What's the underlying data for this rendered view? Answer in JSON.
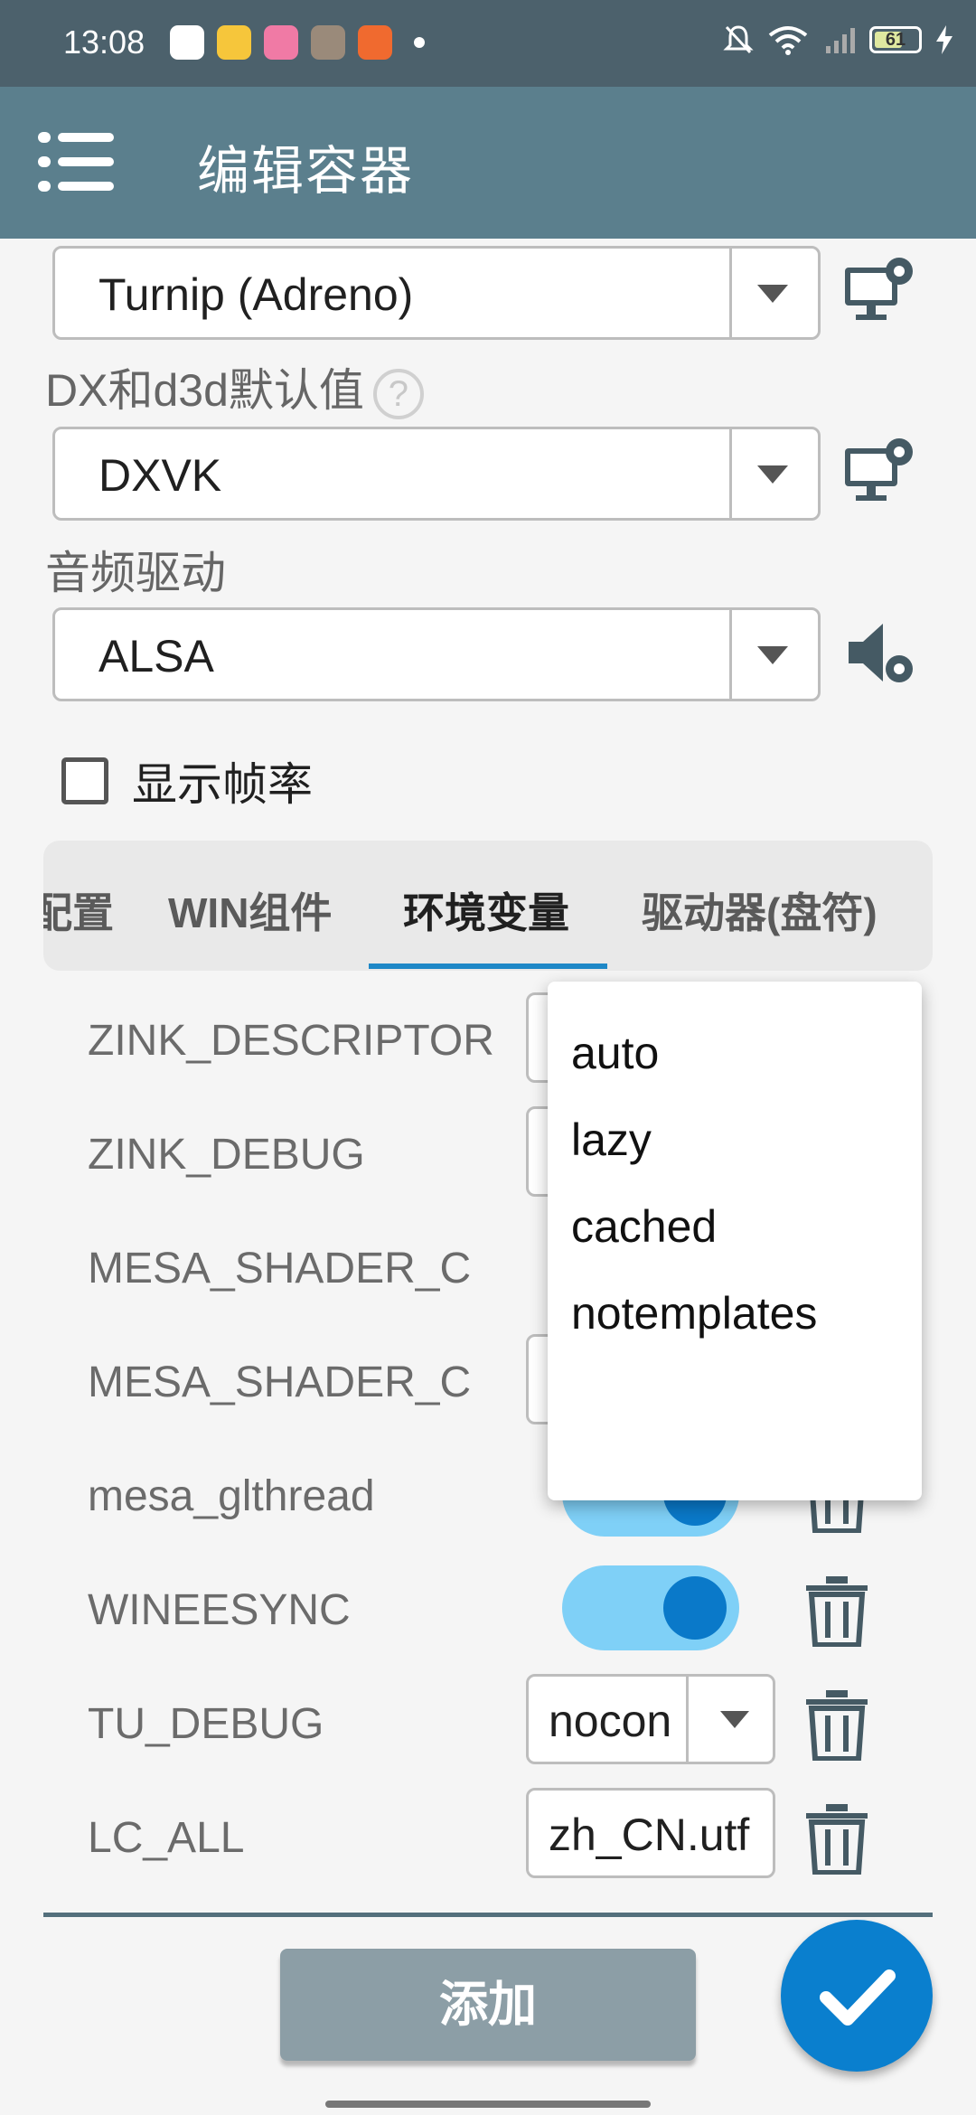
{
  "status_bar": {
    "time": "13:08",
    "battery": "61",
    "apps": [
      {
        "name": "app-icon-1",
        "color": "#ffffff"
      },
      {
        "name": "app-icon-2",
        "color": "#f6c63b"
      },
      {
        "name": "bilibili-icon",
        "color": "#f07aa5"
      },
      {
        "name": "app-icon-4",
        "color": "#9a8a7a"
      },
      {
        "name": "app-icon-5",
        "color": "#f06a2f"
      }
    ]
  },
  "app_bar": {
    "title": "编辑容器"
  },
  "graphics_driver": {
    "value": "Turnip (Adreno)"
  },
  "dx_section": {
    "label": "DX和d3d默认值",
    "help": "?",
    "value": "DXVK"
  },
  "audio_section": {
    "label": "音频驱动",
    "value": "ALSA"
  },
  "show_fps": {
    "label": "显示帧率",
    "checked": false
  },
  "tabs": [
    {
      "label": "配置",
      "active": false
    },
    {
      "label": "WIN组件",
      "active": false
    },
    {
      "label": "环境变量",
      "active": true
    },
    {
      "label": "驱动器(盘符)",
      "active": false
    }
  ],
  "env_vars": [
    {
      "name": "ZINK_DESCRIPTOR",
      "type": "select"
    },
    {
      "name": "ZINK_DEBUG",
      "type": "select"
    },
    {
      "name": "MESA_SHADER_C",
      "type": "text"
    },
    {
      "name": "MESA_SHADER_C",
      "type": "select"
    },
    {
      "name": "mesa_glthread",
      "type": "toggle",
      "on": true
    },
    {
      "name": "WINEESYNC",
      "type": "toggle",
      "on": true
    },
    {
      "name": "TU_DEBUG",
      "type": "select",
      "value": "nocon"
    },
    {
      "name": "LC_ALL",
      "type": "text",
      "value": "zh_CN.utf"
    }
  ],
  "dropdown": {
    "options": [
      "auto",
      "lazy",
      "cached",
      "notemplates"
    ]
  },
  "buttons": {
    "add": "添加"
  },
  "colors": {
    "status_bar": "#4c616c",
    "app_bar": "#5b7f8d",
    "accent": "#1e88c7",
    "fab": "#0a7fce",
    "toggle_track": "#7fd0f7",
    "add_button": "#8c9ea6"
  }
}
